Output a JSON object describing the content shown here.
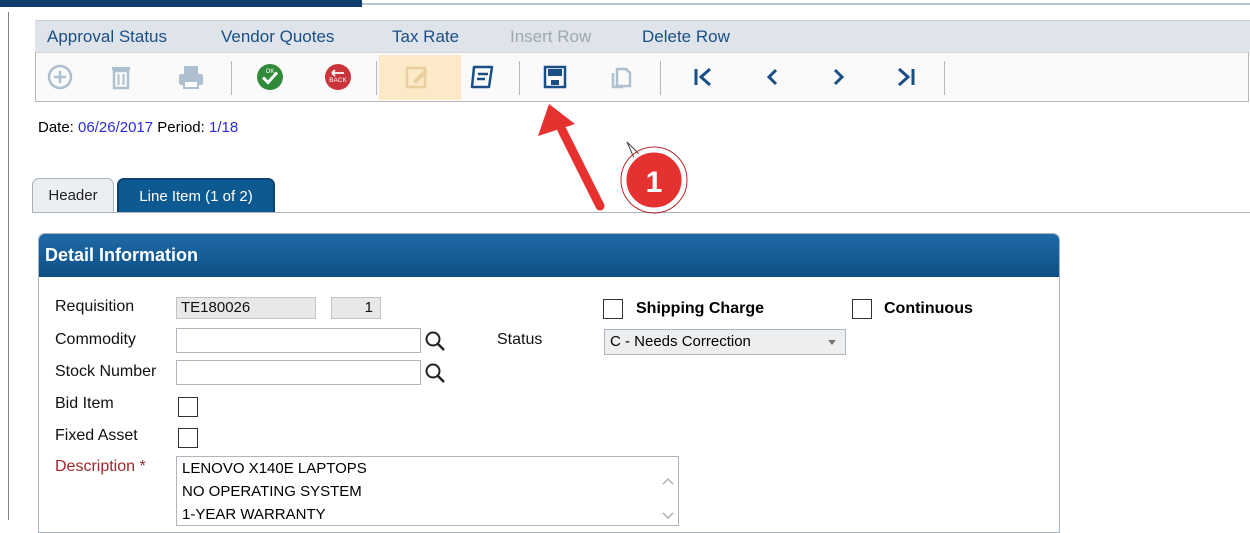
{
  "menu": {
    "items": [
      {
        "label": "Approval Status",
        "enabled": true
      },
      {
        "label": "Vendor Quotes",
        "enabled": true
      },
      {
        "label": "Tax Rate",
        "enabled": true
      },
      {
        "label": "Insert Row",
        "enabled": false
      },
      {
        "label": "Delete Row",
        "enabled": true
      }
    ]
  },
  "toolbar": {
    "buttons": [
      {
        "icon": "add-icon",
        "enabled": false
      },
      {
        "icon": "trash-icon",
        "enabled": false
      },
      {
        "icon": "print-icon",
        "enabled": false
      },
      {
        "icon": "ok-icon",
        "label": "OK",
        "enabled": true
      },
      {
        "icon": "back-icon",
        "label": "BACK",
        "enabled": true
      },
      {
        "icon": "edit-icon",
        "enabled": false
      },
      {
        "icon": "notes-icon",
        "enabled": true
      },
      {
        "icon": "save-icon",
        "enabled": true
      },
      {
        "icon": "copy-icon",
        "enabled": false
      },
      {
        "icon": "first-record-icon",
        "enabled": true
      },
      {
        "icon": "previous-record-icon",
        "enabled": true
      },
      {
        "icon": "next-record-icon",
        "enabled": true
      },
      {
        "icon": "last-record-icon",
        "enabled": true
      }
    ]
  },
  "dateline": {
    "date_label": "Date:",
    "date_value": "06/26/2017",
    "period_label": "Period:",
    "period_value": "1/18"
  },
  "tabs": [
    {
      "label": "Header",
      "active": false
    },
    {
      "label": "Line Item (1 of 2)",
      "active": true
    }
  ],
  "panel": {
    "title": "Detail Information",
    "fields": {
      "requisition_label": "Requisition",
      "requisition_value": "TE180026",
      "line_number_value": "1",
      "commodity_label": "Commodity",
      "commodity_value": "",
      "stock_number_label": "Stock Number",
      "stock_number_value": "",
      "bid_item_label": "Bid Item",
      "fixed_asset_label": "Fixed Asset",
      "description_label": "Description *",
      "description_lines": [
        "LENOVO X140E LAPTOPS",
        "NO OPERATING SYSTEM",
        "1-YEAR WARRANTY"
      ],
      "shipping_charge_label": "Shipping Charge",
      "continuous_label": "Continuous",
      "status_label": "Status",
      "status_value": "C - Needs Correction"
    }
  },
  "annotation": {
    "step_number": "1",
    "color": "#e5312f"
  },
  "colors": {
    "accent": "#0d5a92",
    "menu_text": "#1a4f86",
    "link_value": "#2a2ad8",
    "required": "#a0282a"
  }
}
